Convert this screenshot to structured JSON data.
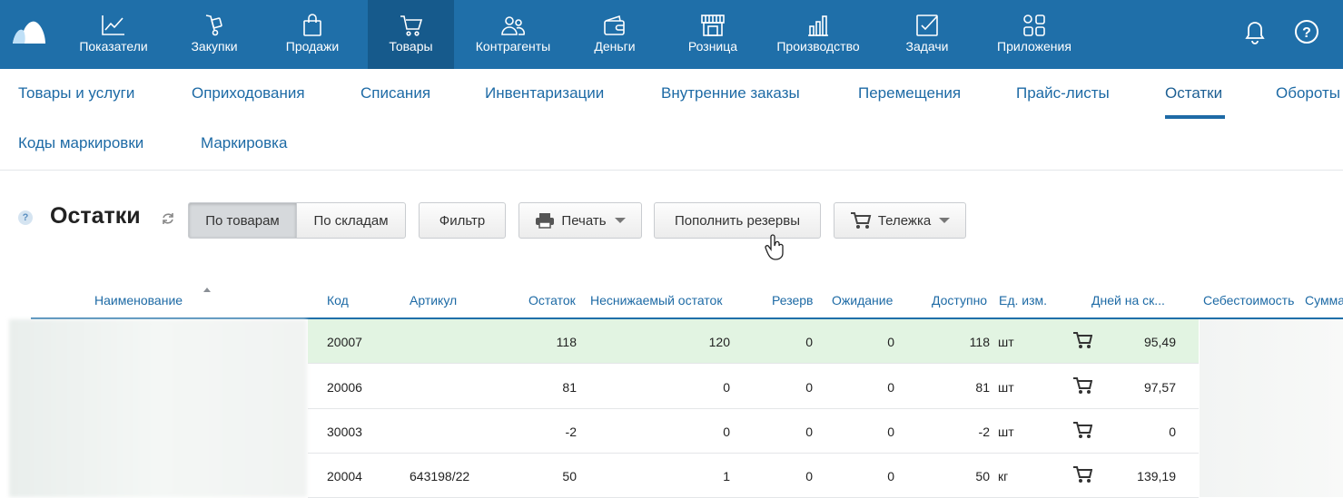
{
  "colors": {
    "topbar": "#1f6fa9",
    "topbar_active": "#165a8c",
    "link": "#1d6aa5",
    "row_highlight": "#e2f4e2"
  },
  "topnav": [
    {
      "label": "Показатели",
      "icon": "chart-line-icon"
    },
    {
      "label": "Закупки",
      "icon": "purchases-icon"
    },
    {
      "label": "Продажи",
      "icon": "shopping-bag-icon"
    },
    {
      "label": "Товары",
      "icon": "cart-icon",
      "active": true
    },
    {
      "label": "Контрагенты",
      "icon": "contacts-icon"
    },
    {
      "label": "Деньги",
      "icon": "wallet-icon"
    },
    {
      "label": "Розница",
      "icon": "store-icon"
    },
    {
      "label": "Производство",
      "icon": "factory-icon"
    },
    {
      "label": "Задачи",
      "icon": "tasks-icon"
    },
    {
      "label": "Приложения",
      "icon": "apps-icon"
    }
  ],
  "subnav": [
    "Товары и услуги",
    "Оприходования",
    "Списания",
    "Инвентаризации",
    "Внутренние заказы",
    "Перемещения",
    "Прайс-листы",
    "Остатки",
    "Обороты",
    "Коды маркировки",
    "Маркировка"
  ],
  "page": {
    "help": "?",
    "title": "Остатки",
    "buttons": {
      "by_goods": "По товарам",
      "by_warehouses": "По складам",
      "filter": "Фильтр",
      "print": "Печать",
      "replenish": "Пополнить резервы",
      "cart": "Тележка"
    }
  },
  "table": {
    "headers": {
      "name": "Наименование",
      "code": "Код",
      "article": "Артикул",
      "stock": "Остаток",
      "min_stock": "Неснижаемый остаток",
      "reserve": "Резерв",
      "waiting": "Ожидание",
      "available": "Доступно",
      "unit": "Ед. изм.",
      "days": "Дней на ск...",
      "cost": "Себестоимость",
      "sum": "Сумма"
    },
    "rows": [
      {
        "code": "20007",
        "article": "",
        "stock": "118",
        "min_stock": "120",
        "reserve": "0",
        "waiting": "0",
        "available": "118",
        "unit": "шт",
        "days": "95,49"
      },
      {
        "code": "20006",
        "article": "",
        "stock": "81",
        "min_stock": "0",
        "reserve": "0",
        "waiting": "0",
        "available": "81",
        "unit": "шт",
        "days": "97,57"
      },
      {
        "code": "30003",
        "article": "",
        "stock": "-2",
        "min_stock": "0",
        "reserve": "0",
        "waiting": "0",
        "available": "-2",
        "unit": "шт",
        "days": "0"
      },
      {
        "code": "20004",
        "article": "643198/22",
        "stock": "50",
        "min_stock": "1",
        "reserve": "0",
        "waiting": "0",
        "available": "50",
        "unit": "кг",
        "days": "139,19"
      }
    ]
  }
}
